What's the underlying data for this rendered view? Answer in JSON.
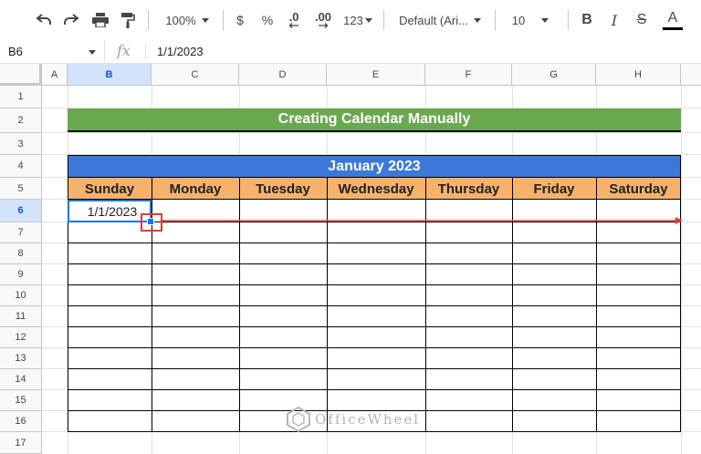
{
  "toolbar": {
    "zoom": "100%",
    "currency": "$",
    "percent": "%",
    "decrease_decimal": ".0",
    "increase_decimal": ".00",
    "more_formats": "123",
    "font": "Default (Ari...",
    "font_size": "10",
    "bold": "B",
    "italic": "I",
    "strikethrough": "S",
    "text_color": "A",
    "icons": [
      "undo-icon",
      "redo-icon",
      "print-icon",
      "paint-format-icon"
    ]
  },
  "formula_bar": {
    "cell_ref": "B6",
    "fx": "fx",
    "value": "1/1/2023"
  },
  "columns": [
    "A",
    "B",
    "C",
    "D",
    "E",
    "F",
    "G",
    "H"
  ],
  "rows": [
    "1",
    "2",
    "3",
    "4",
    "5",
    "6",
    "7",
    "8",
    "9",
    "10",
    "11",
    "12",
    "13",
    "14",
    "15",
    "16",
    "17"
  ],
  "sheet": {
    "title": "Creating Calendar Manually",
    "month": "January 2023",
    "days": [
      "Sunday",
      "Monday",
      "Tuesday",
      "Wednesday",
      "Thursday",
      "Friday",
      "Saturday"
    ],
    "b6_value": "1/1/2023"
  },
  "colors": {
    "title_bg": "#6aa84f",
    "month_bg": "#3c78d8",
    "day_bg": "#f6b26b",
    "selection": "#1a73e8",
    "annotation": "#e53935"
  },
  "watermark": "OfficeWheel"
}
